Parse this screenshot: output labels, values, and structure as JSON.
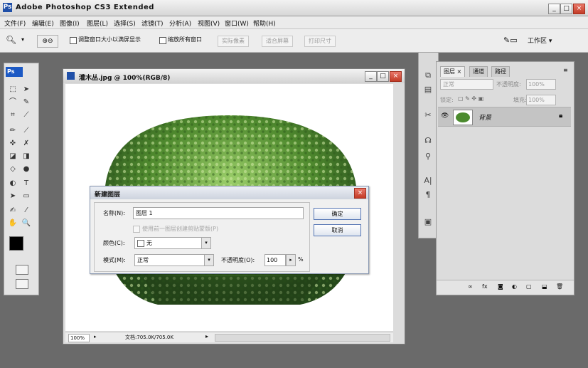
{
  "app": {
    "title": "Adobe Photoshop CS3 Extended",
    "logo": "Ps",
    "window_controls": [
      "_",
      "□",
      "×"
    ]
  },
  "menu": [
    "文件(F)",
    "编辑(E)",
    "图像(I)",
    "图层(L)",
    "选择(S)",
    "滤镜(T)",
    "分析(A)",
    "视图(V)",
    "窗口(W)",
    "帮助(H)"
  ],
  "options_bar": {
    "zoom_tool_icon": "zoom-icon",
    "checkbox1_label": "调整窗口大小以满屏显示",
    "checkbox2_label": "缩放所有窗口",
    "btn_actual": "实际像素",
    "btn_fit": "适合屏幕",
    "btn_print": "打印尺寸",
    "workspace_label": "工作区 ▾"
  },
  "toolbox": {
    "logo": "Ps",
    "tools": [
      "⬚",
      "➤",
      "⌒",
      "✎",
      "⌗",
      "⟋",
      "✏",
      "⟋",
      "✜",
      "✗",
      "◪",
      "◨",
      "◇",
      "●",
      "◐",
      "T",
      "➤",
      "▭",
      "✍",
      "⁄",
      "✋",
      "🔍"
    ]
  },
  "document": {
    "title": "灌木丛.jpg @ 100%(RGB/8)",
    "zoom": "100%",
    "status": "文档:705.0K/705.0K"
  },
  "dialog": {
    "title": "新建图层",
    "name_label": "名称(N):",
    "name_value": "图层 1",
    "clip_label": "使用前一图层创建剪贴蒙版(P)",
    "color_label": "颜色(C):",
    "color_value": "无",
    "mode_label": "模式(M):",
    "mode_value": "正常",
    "opacity_label": "不透明度(O):",
    "opacity_value": "100",
    "opacity_unit": "%",
    "ok": "确定",
    "cancel": "取消"
  },
  "layers_panel": {
    "tabs": [
      "图层 ×",
      "通道",
      "路径"
    ],
    "blend_mode": "正常",
    "opacity_label": "不透明度:",
    "opacity_value": "100%",
    "lock_label": "锁定:",
    "fill_label": "填充:",
    "fill_value": "100%",
    "layer_name": "背景",
    "bottom_icons": [
      "∞",
      "fx",
      "◙",
      "◐",
      "▢",
      "⬓",
      "🗑"
    ]
  },
  "colors": {
    "accent": "#1c59c4",
    "dialog_border": "#8796b0",
    "close_red": "#c23b26"
  }
}
